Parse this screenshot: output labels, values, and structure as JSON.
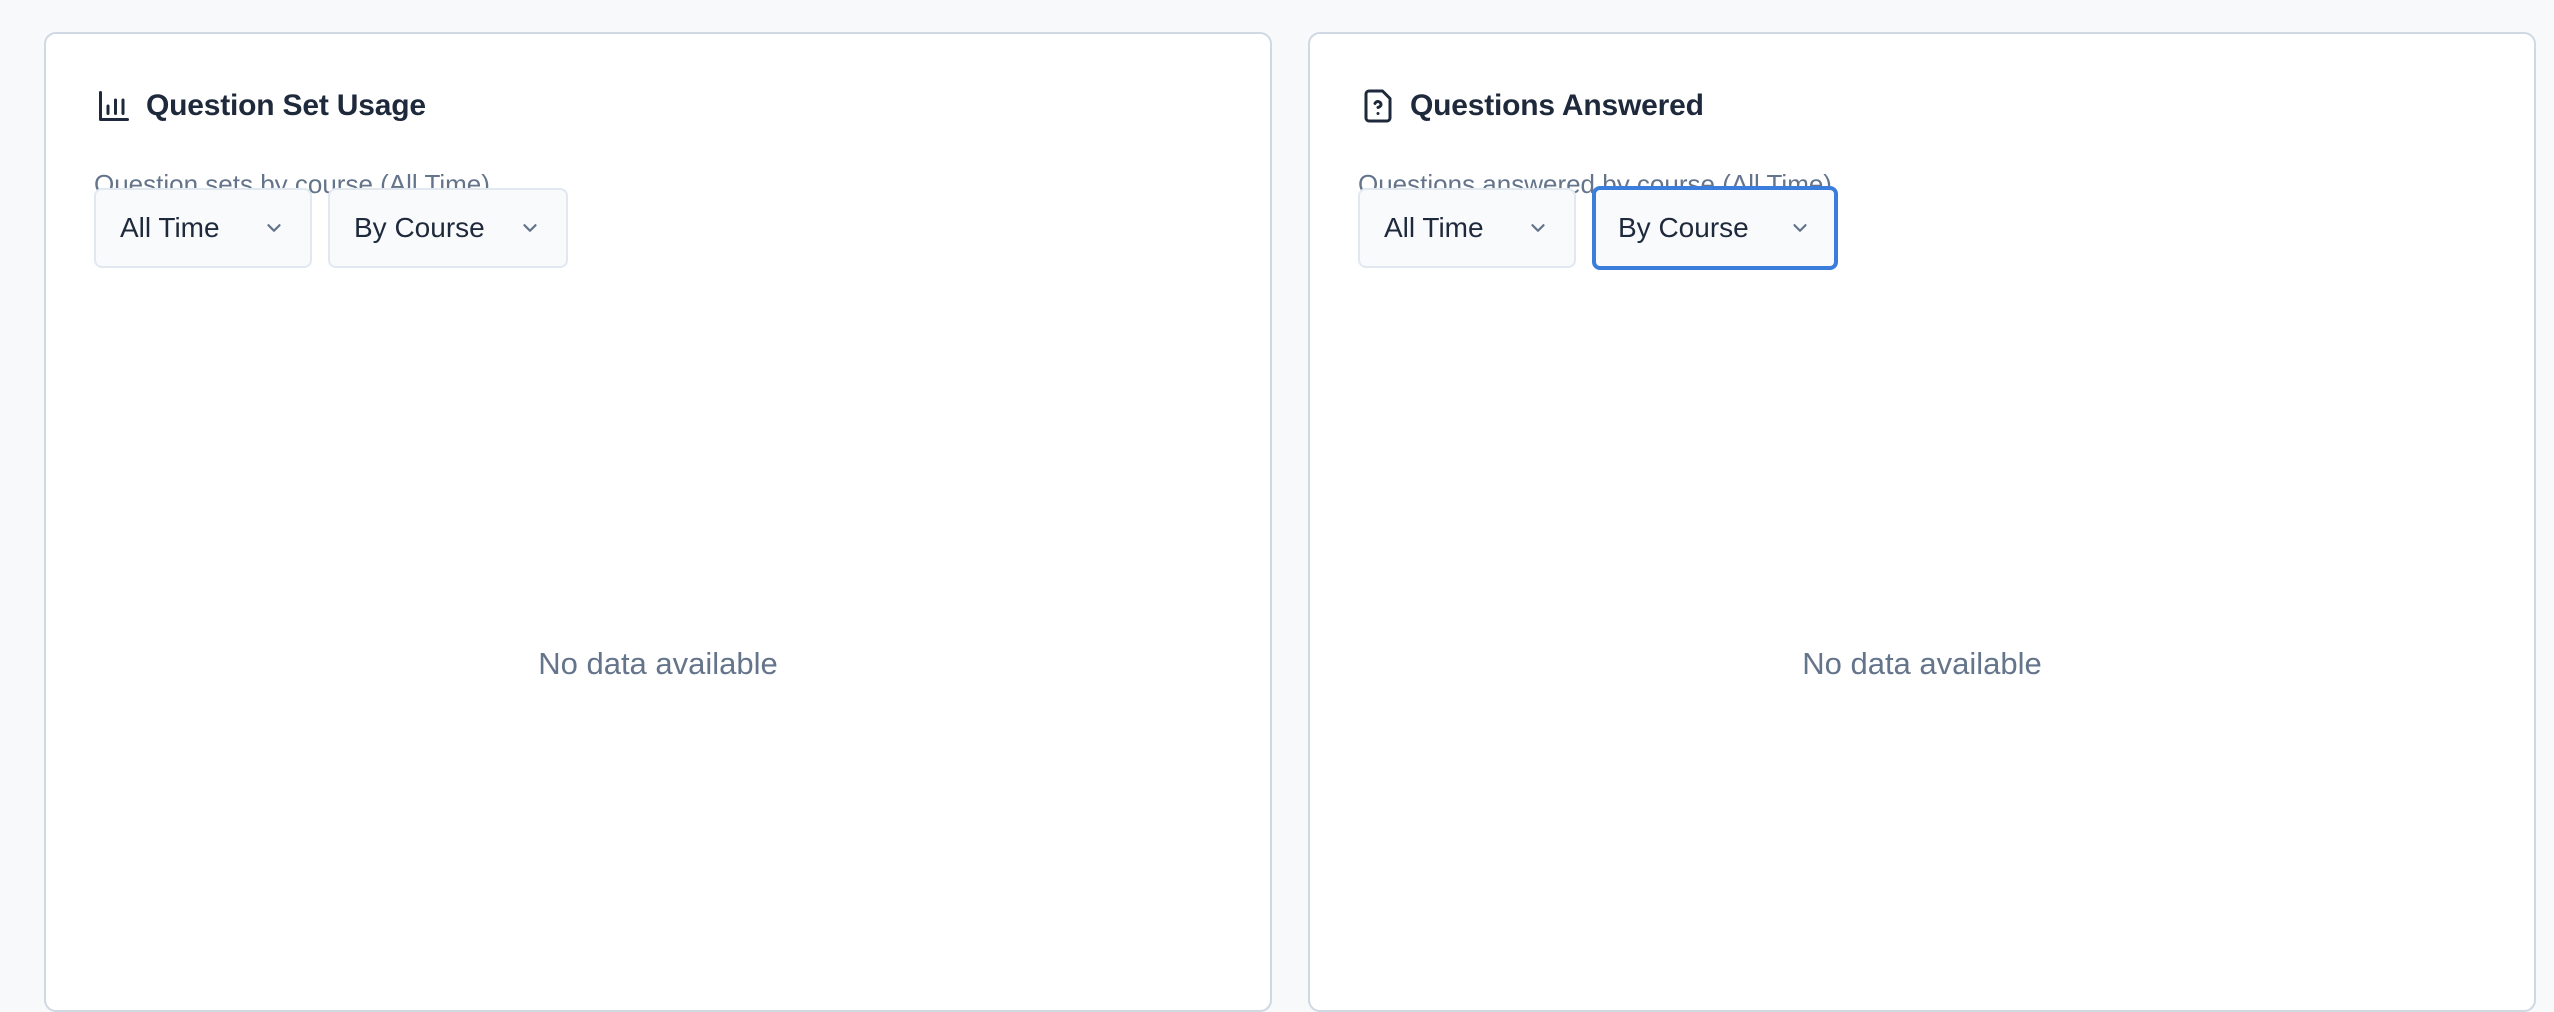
{
  "cards": [
    {
      "title": "Question Set Usage",
      "subtitle": "Question sets by course (All Time)",
      "icon": "bar-chart-icon",
      "time_filter": "All Time",
      "group_filter": "By Course",
      "empty_message": "No data available"
    },
    {
      "title": "Questions Answered",
      "subtitle": "Questions answered by course (All Time)",
      "icon": "file-question-icon",
      "time_filter": "All Time",
      "group_filter": "By Course",
      "empty_message": "No data available"
    }
  ],
  "colors": {
    "background": "#f7f9fb",
    "card_border": "#cfd8e3",
    "title": "#1e293b",
    "muted_text": "#64748b",
    "focus_ring": "#3b7ddd"
  }
}
